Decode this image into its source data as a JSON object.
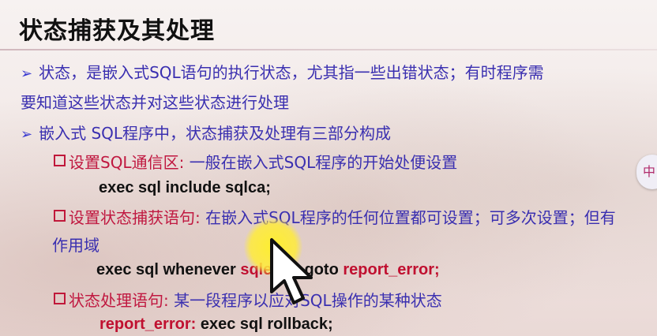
{
  "slide": {
    "title": "状态捕获及其处理",
    "bullet_marker": "➢",
    "bullet1_line1": "状态，是嵌入式SQL语句的执行状态，尤其指一些出错状态；有时程序需",
    "bullet1_line2": "要知道这些状态并对这些状态进行处理",
    "bullet2": "嵌入式 SQL程序中，状态捕获及处理有三部分构成",
    "items": [
      {
        "label": "设置SQL通信区:",
        "desc": "一般在嵌入式SQL程序的开始处便设置",
        "code": "exec  sql  include sqlca;"
      },
      {
        "label": "设置状态捕获语句:",
        "desc": "在嵌入式SQL程序的任何位置都可设置；可多次设置；但有",
        "desc_line2": "作用域",
        "code_a": "exec sql whenever",
        "code_b": "sqlerror",
        "code_c": "goto",
        "code_d": "report_error;"
      },
      {
        "label": "状态处理语句:",
        "desc": "某一段程序以应对SQL操作的某种状态",
        "code_label": "report_error:",
        "code": "exec sql rollback;"
      }
    ]
  },
  "overlay": {
    "side_button_glyph": "中"
  },
  "colors": {
    "title": "#111111",
    "bullet_text": "#3a2fb0",
    "sub_label": "#c01840",
    "code_red": "#c01030",
    "highlight": "#ffeb28"
  },
  "icons": {
    "bullet": "arrow-bullet-icon",
    "checkbox": "square-bullet-icon",
    "cursor": "mouse-pointer-icon"
  }
}
